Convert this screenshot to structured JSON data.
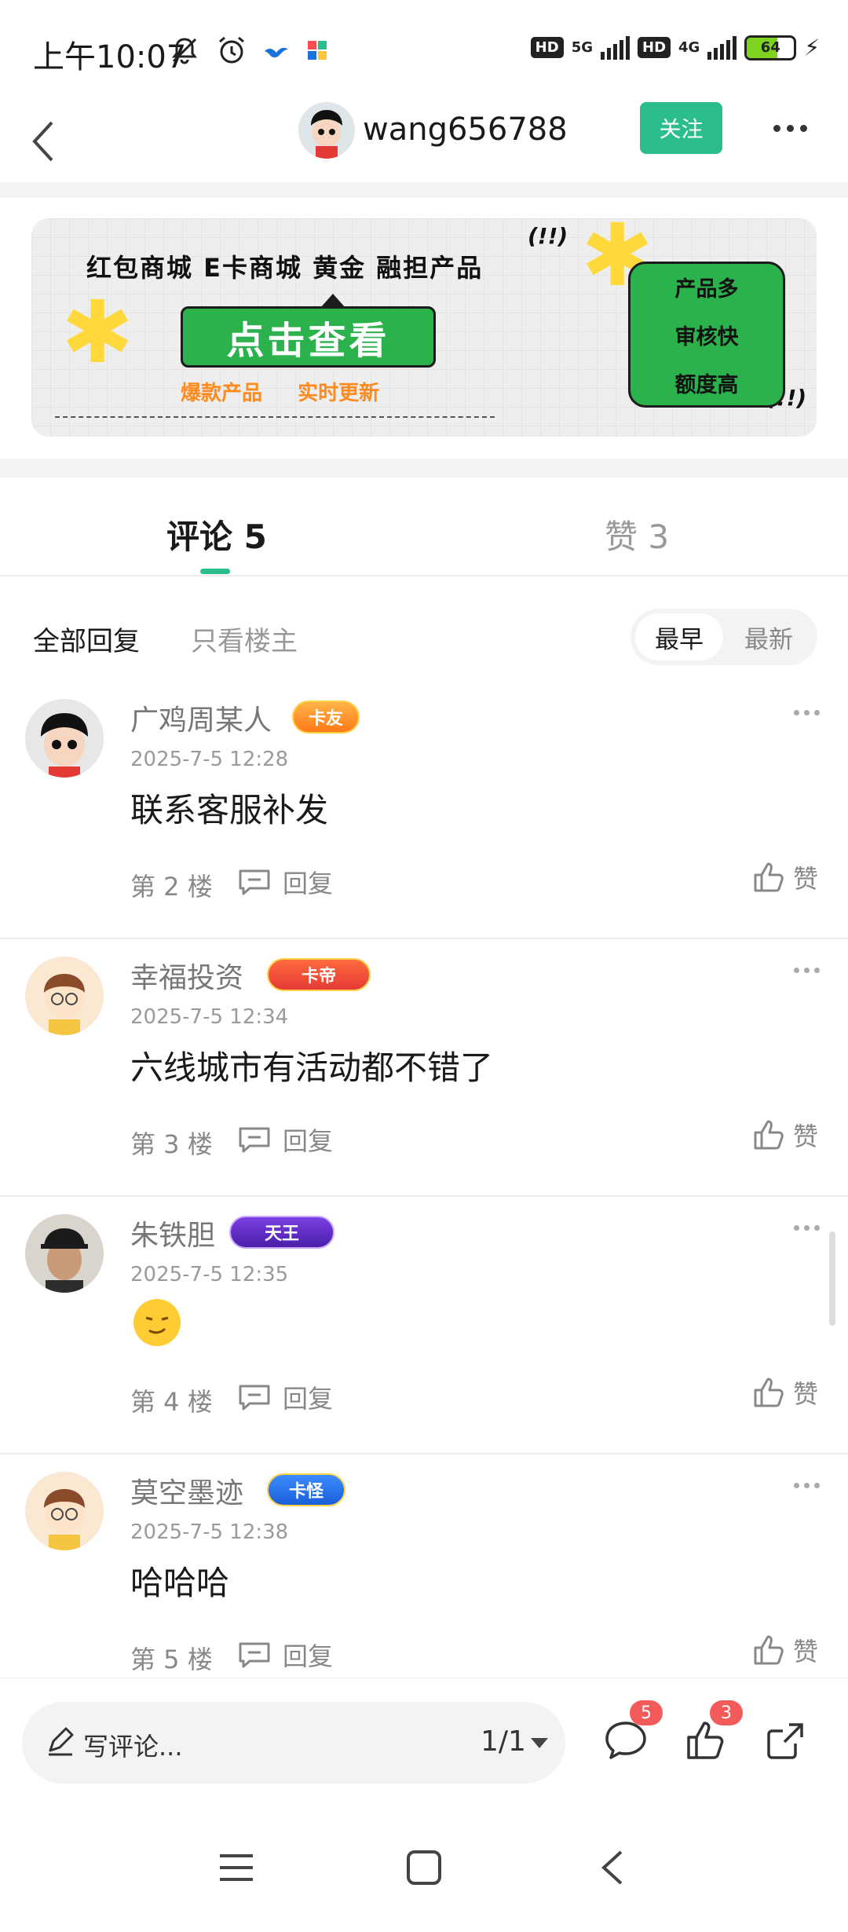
{
  "status_bar": {
    "time": "上午10:07",
    "network_1": "5G",
    "network_2": "4G",
    "hd_label": "HD",
    "battery": "64"
  },
  "header": {
    "username": "wang656788",
    "follow_label": "关注"
  },
  "banner": {
    "categories": "红包商城  E卡商城  黄金  融担产品",
    "cta": "点击查看",
    "sub_1": "爆款产品",
    "sub_2": "实时更新",
    "excl": "(!!)",
    "features": [
      "产品多",
      "审核快",
      "额度高"
    ]
  },
  "tabs": {
    "comments": "评论 5",
    "likes": "赞 3"
  },
  "filters": {
    "all_replies": "全部回复",
    "only_op": "只看楼主",
    "sort_earliest": "最早",
    "sort_newest": "最新"
  },
  "comments": [
    {
      "name": "广鸡周某人",
      "badge": "卡友",
      "time": "2025-7-5 12:28",
      "text": "联系客服补发",
      "floor": "第 2 楼",
      "reply": "回复",
      "like": "赞"
    },
    {
      "name": "幸福投资",
      "badge": "卡帝",
      "time": "2025-7-5 12:34",
      "text": "六线城市有活动都不错了",
      "floor": "第 3 楼",
      "reply": "回复",
      "like": "赞"
    },
    {
      "name": "朱铁胆",
      "badge": "天王",
      "time": "2025-7-5 12:35",
      "text": "",
      "floor": "第 4 楼",
      "reply": "回复",
      "like": "赞"
    },
    {
      "name": "莫空墨迹",
      "badge": "卡怪",
      "time": "2025-7-5 12:38",
      "text": "哈哈哈",
      "floor": "第 5 楼",
      "reply": "回复",
      "like": "赞"
    }
  ],
  "bottom_bar": {
    "placeholder": "写评论...",
    "page_indicator": "1/1",
    "comment_count": "5",
    "like_count": "3"
  },
  "colors": {
    "accent": "#2bbd8d",
    "badge_red": "#f35a5a",
    "banner_green": "#2bb24c",
    "banner_orange": "#ff8a1e"
  }
}
